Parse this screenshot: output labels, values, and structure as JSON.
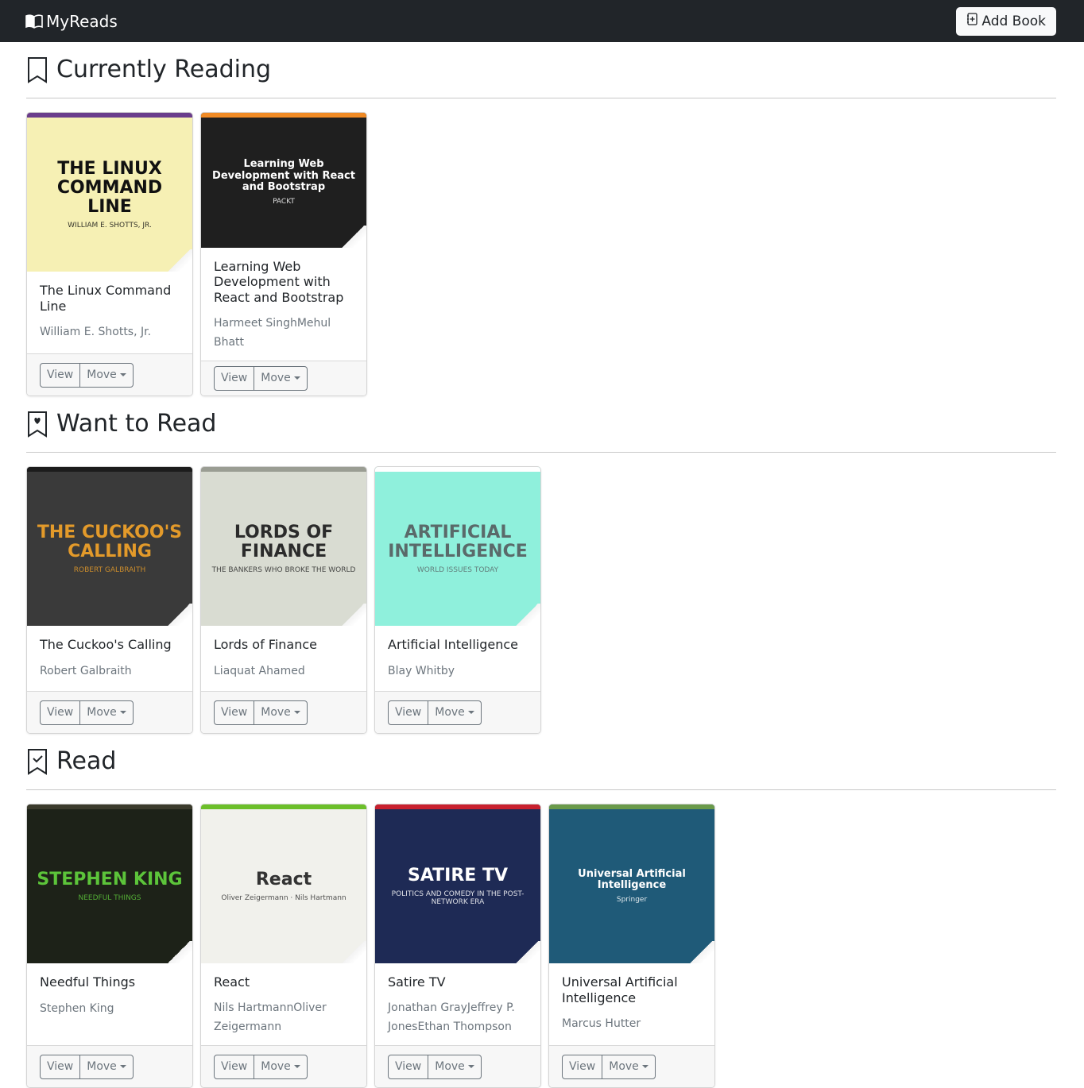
{
  "nav": {
    "brand": "MyReads",
    "add_label": "Add Book"
  },
  "buttons": {
    "view": "View",
    "move": "Move"
  },
  "shelves": [
    {
      "title": "Currently Reading",
      "icon": "bookmark-icon",
      "books": [
        {
          "title": "The Linux Command Line",
          "authors": "William E. Shotts, Jr.",
          "cover": {
            "text": "THE LINUX COMMAND LINE",
            "sub": "WILLIAM E. SHOTTS, JR.",
            "bg": "#f6f0b4",
            "fg": "#111111",
            "accent": "#6a3d8c"
          }
        },
        {
          "title": "Learning Web Development with React and Bootstrap",
          "authors": "Harmeet SinghMehul Bhatt",
          "cover": {
            "text": "Learning Web Development with React and Bootstrap",
            "sub": "PACKT",
            "bg": "#1f1f1f",
            "fg": "#ffffff",
            "accent": "#f08a24"
          }
        }
      ]
    },
    {
      "title": "Want to Read",
      "icon": "bookmark-heart-icon",
      "books": [
        {
          "title": "The Cuckoo's Calling",
          "authors": "Robert Galbraith",
          "cover": {
            "text": "THE CUCKOO'S CALLING",
            "sub": "ROBERT GALBRAITH",
            "bg": "#3a3a3a",
            "fg": "#e39a2a",
            "accent": "#1c1c1c"
          }
        },
        {
          "title": "Lords of Finance",
          "authors": "Liaquat Ahamed",
          "cover": {
            "text": "LORDS OF FINANCE",
            "sub": "THE BANKERS WHO BROKE THE WORLD",
            "bg": "#d9dcd2",
            "fg": "#2b2b2b",
            "accent": "#9a9d93"
          }
        },
        {
          "title": "Artificial Intelligence",
          "authors": "Blay Whitby",
          "cover": {
            "text": "ARTIFICIAL INTELLIGENCE",
            "sub": "WORLD ISSUES TODAY",
            "bg": "#8ff0dc",
            "fg": "#5a6a6a",
            "accent": "#ffffff"
          }
        }
      ]
    },
    {
      "title": "Read",
      "icon": "bookmark-check-icon",
      "books": [
        {
          "title": "Needful Things",
          "authors": "Stephen King",
          "cover": {
            "text": "STEPHEN KING",
            "sub": "NEEDFUL THINGS",
            "bg": "#1d2218",
            "fg": "#5cc43a",
            "accent": "#3b3b2c"
          }
        },
        {
          "title": "React",
          "authors": "Nils HartmannOliver Zeigermann",
          "cover": {
            "text": "React",
            "sub": "Oliver Zeigermann · Nils Hartmann",
            "bg": "#f1f1ec",
            "fg": "#333333",
            "accent": "#6cbf2a"
          }
        },
        {
          "title": "Satire TV",
          "authors": "Jonathan GrayJeffrey P. JonesEthan Thompson",
          "cover": {
            "text": "SATIRE TV",
            "sub": "POLITICS AND COMEDY IN THE POST-NETWORK ERA",
            "bg": "#1e2a55",
            "fg": "#ffffff",
            "accent": "#c8202e"
          }
        },
        {
          "title": "Universal Artificial Intelligence",
          "authors": "Marcus Hutter",
          "cover": {
            "text": "Universal Artificial Intelligence",
            "sub": "Springer",
            "bg": "#1f5a78",
            "fg": "#ffffff",
            "accent": "#6a9a4a"
          }
        }
      ]
    }
  ]
}
